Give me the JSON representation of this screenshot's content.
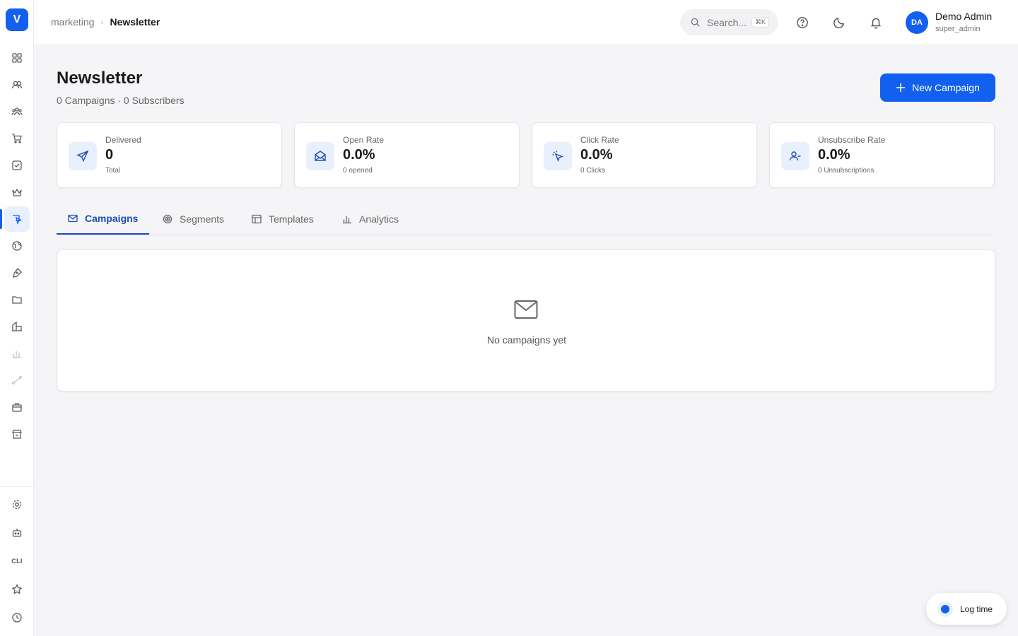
{
  "app": {
    "logo_letter": "V",
    "accent_color": "#1260f0"
  },
  "breadcrumb": {
    "parent": "marketing",
    "current": "Newsletter"
  },
  "search": {
    "placeholder": "Search...",
    "shortcut": "⌘K"
  },
  "user": {
    "initials": "DA",
    "name": "Demo Admin",
    "role": "super_admin"
  },
  "sidebar": {
    "items": [
      {
        "icon": "dashboard-grid-icon"
      },
      {
        "icon": "users-icon"
      },
      {
        "icon": "team-icon"
      },
      {
        "icon": "cart-icon"
      },
      {
        "icon": "task-check-icon"
      },
      {
        "icon": "crown-icon"
      },
      {
        "icon": "marketing-megaphone-icon",
        "active": true
      },
      {
        "icon": "globe-icon"
      },
      {
        "icon": "pen-tool-icon"
      },
      {
        "icon": "folder-icon"
      },
      {
        "icon": "building-icon"
      },
      {
        "icon": "bar-chart-icon"
      },
      {
        "icon": "workflow-icon"
      },
      {
        "icon": "gift-box-icon"
      },
      {
        "icon": "store-icon"
      }
    ],
    "bottom_items": [
      {
        "icon": "settings-gear-icon"
      },
      {
        "icon": "bot-icon"
      },
      {
        "label": "CLI"
      },
      {
        "icon": "star-icon"
      },
      {
        "icon": "clock-icon"
      }
    ]
  },
  "page": {
    "title": "Newsletter",
    "subtitle": "0 Campaigns · 0 Subscribers",
    "new_button_label": "New Campaign"
  },
  "stats": [
    {
      "label": "Delivered",
      "value": "0",
      "sub": "Total",
      "icon": "send-icon"
    },
    {
      "label": "Open Rate",
      "value": "0.0%",
      "sub": "0 opened",
      "icon": "mail-open-icon"
    },
    {
      "label": "Click Rate",
      "value": "0.0%",
      "sub": "0 Clicks",
      "icon": "cursor-click-icon"
    },
    {
      "label": "Unsubscribe Rate",
      "value": "0.0%",
      "sub": "0 Unsubscriptions",
      "icon": "user-minus-icon"
    }
  ],
  "tabs": [
    {
      "label": "Campaigns",
      "icon": "mail-icon",
      "active": true
    },
    {
      "label": "Segments",
      "icon": "target-icon"
    },
    {
      "label": "Templates",
      "icon": "layout-icon"
    },
    {
      "label": "Analytics",
      "icon": "bar-chart-icon"
    }
  ],
  "empty_state": {
    "message": "No campaigns yet",
    "icon": "mail-icon"
  },
  "floating": {
    "log_time_label": "Log time"
  }
}
